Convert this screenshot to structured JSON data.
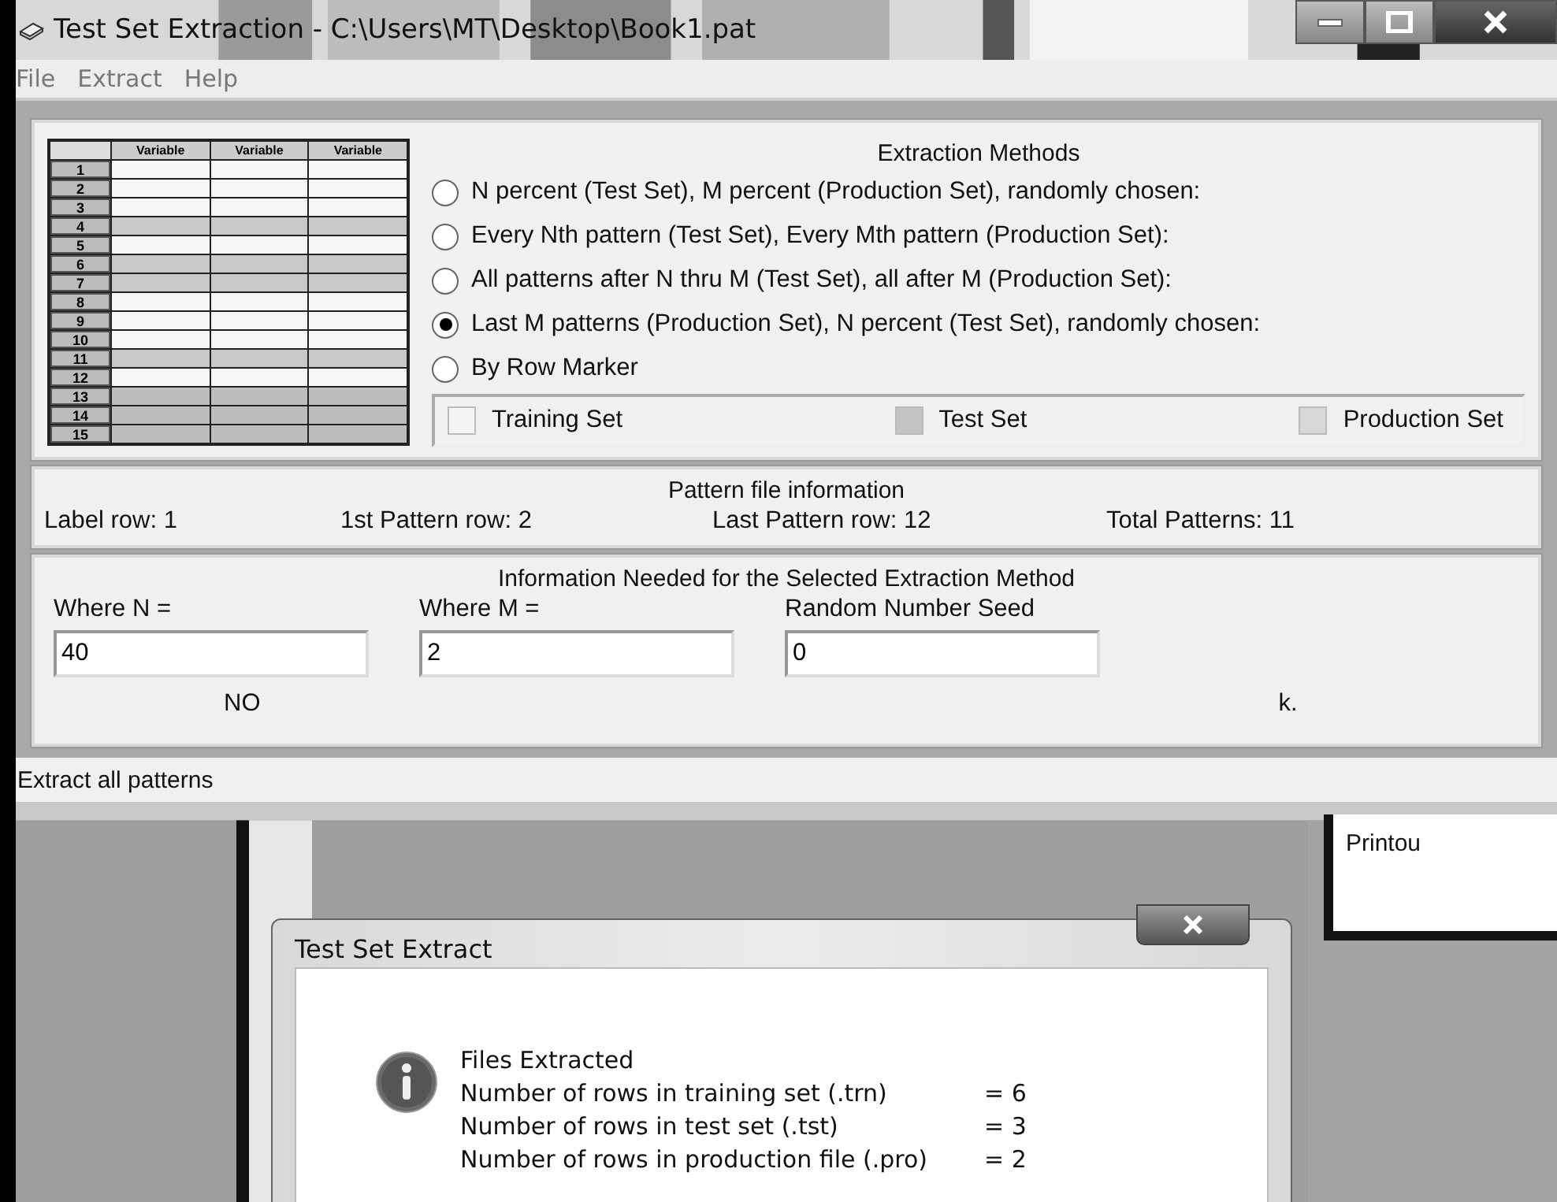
{
  "window": {
    "title": "Test Set Extraction - C:\\Users\\MT\\Desktop\\Book1.pat"
  },
  "menu": [
    "File",
    "Extract",
    "Help"
  ],
  "sheet_preview": {
    "columns": [
      "Variable",
      "Variable",
      "Variable"
    ],
    "rows": [
      {
        "label": "1",
        "kind": "training"
      },
      {
        "label": "2",
        "kind": "training"
      },
      {
        "label": "3",
        "kind": "training"
      },
      {
        "label": "4",
        "kind": "test"
      },
      {
        "label": "5",
        "kind": "training"
      },
      {
        "label": "6",
        "kind": "test"
      },
      {
        "label": "7",
        "kind": "test"
      },
      {
        "label": "8",
        "kind": "training"
      },
      {
        "label": "9",
        "kind": "training"
      },
      {
        "label": "10",
        "kind": "training"
      },
      {
        "label": "11",
        "kind": "test"
      },
      {
        "label": "12",
        "kind": "training"
      },
      {
        "label": "13",
        "kind": "empty"
      },
      {
        "label": "14",
        "kind": "empty"
      },
      {
        "label": "15",
        "kind": "empty"
      }
    ]
  },
  "extraction_methods": {
    "title": "Extraction Methods",
    "options": [
      {
        "label": " N percent (Test Set), M percent (Production Set), randomly chosen:",
        "selected": false
      },
      {
        "label": "Every Nth pattern (Test Set), Every Mth pattern (Production Set):",
        "selected": false
      },
      {
        "label": "All patterns after N thru M (Test Set), all after M (Production Set):",
        "selected": false
      },
      {
        "label": "Last M patterns (Production Set), N percent (Test Set), randomly chosen:",
        "selected": true
      },
      {
        "label": "By Row Marker",
        "selected": false
      }
    ],
    "legend": [
      {
        "label": "Training Set",
        "color": "#f4f4f4"
      },
      {
        "label": "Test Set",
        "color": "#c4c4c4"
      },
      {
        "label": "Production Set",
        "color": "#d8d8d8"
      }
    ]
  },
  "pattern_info": {
    "title": "Pattern file information",
    "items": [
      "Label row: 1",
      "1st Pattern row: 2",
      "Last Pattern row: 12",
      "Total Patterns: 11"
    ]
  },
  "parameters": {
    "title": "Information Needed for the Selected Extraction Method",
    "fields": [
      {
        "label": "Where N =",
        "value": "40"
      },
      {
        "label": "Where M =",
        "value": "2"
      },
      {
        "label": "Random Number Seed",
        "value": "0"
      }
    ],
    "note_start": "NO",
    "note_end": "k."
  },
  "status_bar": "Extract all patterns",
  "background_app": {
    "label": "Printou"
  },
  "dialog": {
    "title": "Test Set Extract",
    "heading": "Files Extracted",
    "lines": [
      {
        "label": "Number of rows in training set (.trn)",
        "value": "= 6"
      },
      {
        "label": "Number of rows in test set (.tst)",
        "value": "= 3"
      },
      {
        "label": "Number of rows in production file (.pro)",
        "value": "= 2"
      }
    ]
  }
}
